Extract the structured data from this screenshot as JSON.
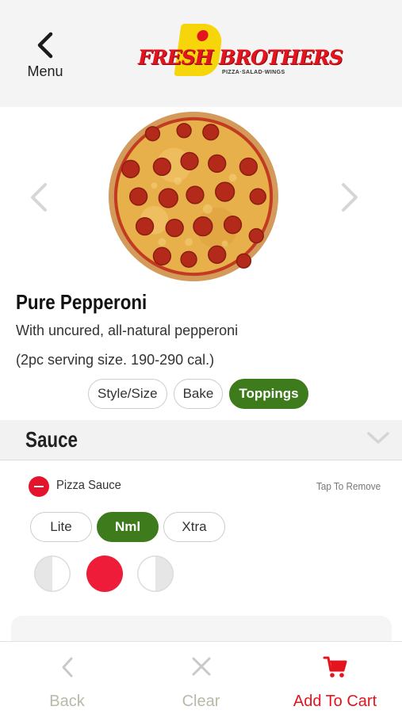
{
  "header": {
    "menu_label": "Menu",
    "logo_text": "FRESH BROTHERS",
    "logo_tagline": "PIZZA·SALAD·WINGS"
  },
  "product": {
    "name": "Pure Pepperoni",
    "description": "With uncured, all-natural pepperoni",
    "serving": "(2pc serving size. 190-290 cal.)"
  },
  "tabs": [
    {
      "label": "Style/Size",
      "active": false
    },
    {
      "label": "Bake",
      "active": false
    },
    {
      "label": "Toppings",
      "active": true
    }
  ],
  "sauce_section": {
    "title": "Sauce",
    "item_name": "Pizza Sauce",
    "tap_hint": "Tap To Remove",
    "amounts": [
      {
        "label": "Lite",
        "active": false
      },
      {
        "label": "Nml",
        "active": true
      },
      {
        "label": "Xtra",
        "active": false
      }
    ],
    "portion_selected": "whole"
  },
  "footer": {
    "back_label": "Back",
    "clear_label": "Clear",
    "cart_label": "Add To Cart"
  },
  "colors": {
    "accent_green": "#3e7b1c",
    "brand_red": "#e4141f",
    "sauce_red": "#ee1c38",
    "header_bg": "#f4f4f4"
  }
}
